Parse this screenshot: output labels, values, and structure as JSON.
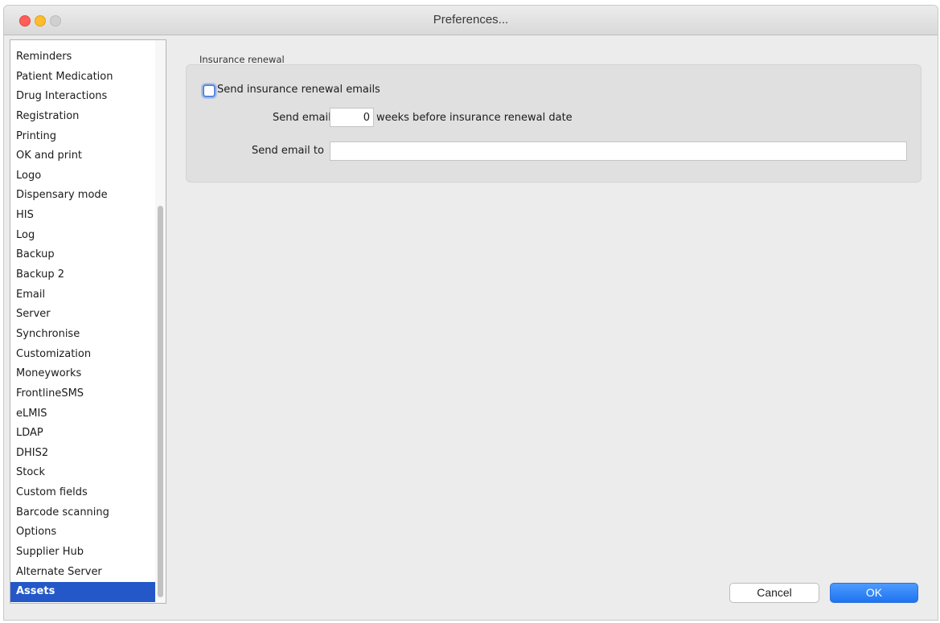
{
  "window": {
    "title": "Preferences..."
  },
  "sidebar": {
    "items": [
      {
        "label": "Reminders"
      },
      {
        "label": "Patient Medication"
      },
      {
        "label": "Drug Interactions"
      },
      {
        "label": "Registration"
      },
      {
        "label": "Printing"
      },
      {
        "label": "OK and print"
      },
      {
        "label": "Logo"
      },
      {
        "label": "Dispensary mode"
      },
      {
        "label": "HIS"
      },
      {
        "label": "Log"
      },
      {
        "label": "Backup"
      },
      {
        "label": "Backup 2"
      },
      {
        "label": "Email"
      },
      {
        "label": "Server"
      },
      {
        "label": "Synchronise"
      },
      {
        "label": "Customization"
      },
      {
        "label": "Moneyworks"
      },
      {
        "label": "FrontlineSMS"
      },
      {
        "label": "eLMIS"
      },
      {
        "label": "LDAP"
      },
      {
        "label": "DHIS2"
      },
      {
        "label": "Stock"
      },
      {
        "label": "Custom fields"
      },
      {
        "label": "Barcode scanning"
      },
      {
        "label": "Options"
      },
      {
        "label": "Supplier Hub"
      },
      {
        "label": "Alternate Server"
      },
      {
        "label": "Assets"
      }
    ],
    "selected": "Assets"
  },
  "panel": {
    "group_title": "Insurance renewal",
    "send_emails_label": "Send insurance renewal emails",
    "send_emails_checked": false,
    "send_email_label": "Send email",
    "weeks_value": "0",
    "weeks_suffix": "weeks before insurance renewal date",
    "send_to_label": "Send email  to",
    "send_to_value": ""
  },
  "buttons": {
    "cancel": "Cancel",
    "ok": "OK"
  },
  "colors": {
    "accent": "#2458c8",
    "ok_button": "#1f74f0"
  }
}
